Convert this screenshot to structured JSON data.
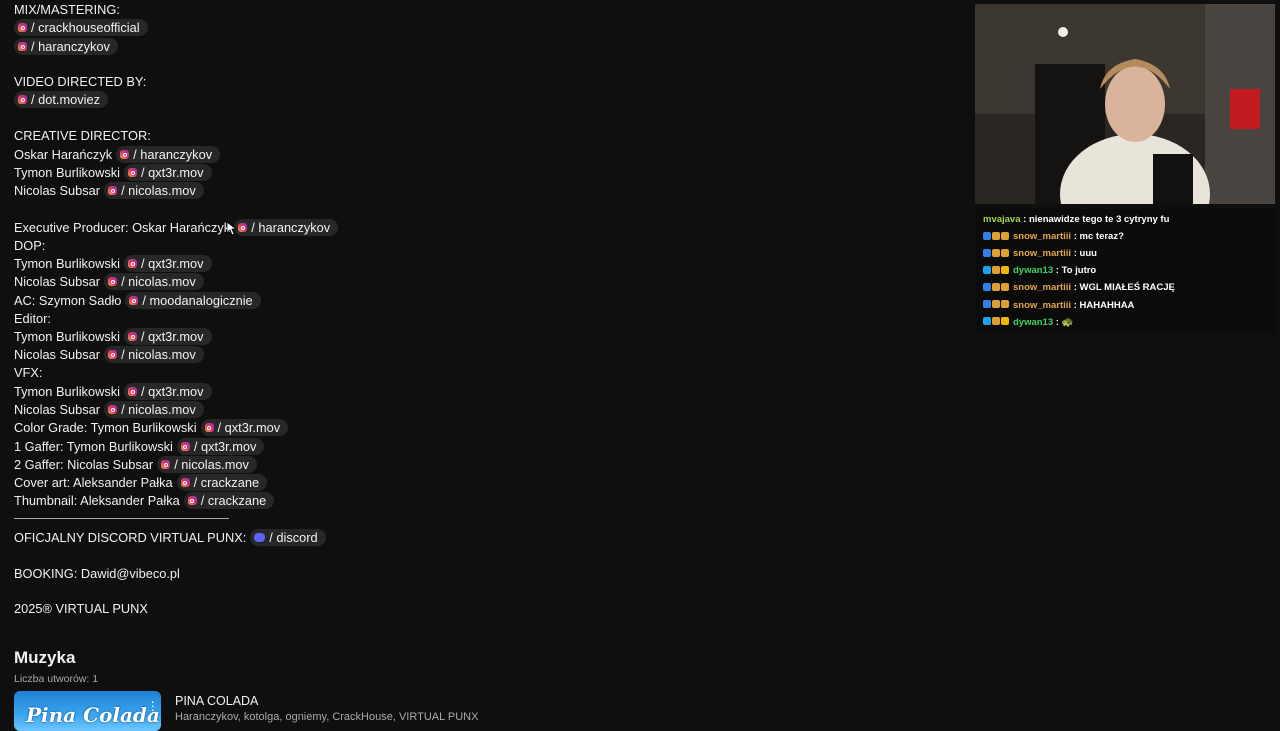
{
  "description": {
    "lines": [
      {
        "text": "MIX/MASTERING:",
        "chips": []
      },
      {
        "text": "",
        "chips": [
          {
            "icon": "instagram-icon",
            "label": "/ crackhouseofficial"
          }
        ]
      },
      {
        "text": "",
        "chips": [
          {
            "icon": "instagram-icon",
            "label": "/ haranczykov"
          }
        ]
      },
      {
        "text": "VIDEO DIRECTED BY:",
        "chips": []
      },
      {
        "text": "",
        "chips": [
          {
            "icon": "instagram-icon",
            "label": "/ dot.moviez"
          }
        ]
      },
      {
        "text": "CREATIVE DIRECTOR:",
        "chips": []
      },
      {
        "text": "Oskar Harańczyk",
        "chips": [
          {
            "icon": "instagram-icon",
            "label": "/ haranczykov"
          }
        ]
      },
      {
        "text": "Tymon Burlikowski",
        "chips": [
          {
            "icon": "instagram-icon",
            "label": "/ qxt3r.mov"
          }
        ]
      },
      {
        "text": "Nicolas Subsar",
        "chips": [
          {
            "icon": "instagram-icon",
            "label": "/ nicolas.mov"
          }
        ]
      },
      {
        "text": "Executive Producer: Oskar Harańczyk",
        "chips": [
          {
            "icon": "instagram-icon",
            "label": "/ haranczykov"
          }
        ]
      },
      {
        "text": "DOP:",
        "chips": []
      },
      {
        "text": "Tymon Burlikowski",
        "chips": [
          {
            "icon": "instagram-icon",
            "label": "/ qxt3r.mov"
          }
        ]
      },
      {
        "text": "Nicolas Subsar",
        "chips": [
          {
            "icon": "instagram-icon",
            "label": "/ nicolas.mov"
          }
        ]
      },
      {
        "text": "AC: Szymon Sadło",
        "chips": [
          {
            "icon": "instagram-icon",
            "label": "/ moodanalogicznie"
          }
        ]
      },
      {
        "text": "Editor:",
        "chips": []
      },
      {
        "text": "Tymon Burlikowski",
        "chips": [
          {
            "icon": "instagram-icon",
            "label": "/ qxt3r.mov"
          }
        ]
      },
      {
        "text": "Nicolas Subsar",
        "chips": [
          {
            "icon": "instagram-icon",
            "label": "/ nicolas.mov"
          }
        ]
      },
      {
        "text": "VFX:",
        "chips": []
      },
      {
        "text": "Tymon Burlikowski",
        "chips": [
          {
            "icon": "instagram-icon",
            "label": "/ qxt3r.mov"
          }
        ]
      },
      {
        "text": "Nicolas Subsar",
        "chips": [
          {
            "icon": "instagram-icon",
            "label": "/ nicolas.mov"
          }
        ]
      },
      {
        "text": "Color Grade: Tymon Burlikowski",
        "chips": [
          {
            "icon": "instagram-icon",
            "label": "/ qxt3r.mov"
          }
        ]
      },
      {
        "text": "1 Gaffer: Tymon Burlikowski",
        "chips": [
          {
            "icon": "instagram-icon",
            "label": "/ qxt3r.mov"
          }
        ]
      },
      {
        "text": "2 Gaffer: Nicolas Subsar",
        "chips": [
          {
            "icon": "instagram-icon",
            "label": "/ nicolas.mov"
          }
        ]
      },
      {
        "text": "Cover art: Aleksander Pałka",
        "chips": [
          {
            "icon": "instagram-icon",
            "label": "/ crackzane"
          }
        ]
      },
      {
        "text": "Thumbnail: Aleksander Pałka",
        "chips": [
          {
            "icon": "instagram-icon",
            "label": "/ crackzane"
          }
        ]
      },
      {
        "text": "———————————————————",
        "chips": []
      },
      {
        "text": "OFICJALNY DISCORD VIRTUAL PUNX:",
        "chips": [
          {
            "icon": "discord-icon",
            "label": "/ discord"
          }
        ]
      },
      {
        "text": "BOOKING: Dawid@vibeco.pl",
        "chips": []
      },
      {
        "text": "2025® VIRTUAL PUNX",
        "chips": []
      }
    ]
  },
  "music": {
    "title": "Muzyka",
    "count_label": "Liczba utworów: 1",
    "thumbnail_text": "Pina Colada",
    "track_title": "PINA COLADA",
    "track_artists": "Haranczykov, kotolga, ogniemy, CrackHouse, VIRTUAL PUNX"
  },
  "chat": {
    "messages": [
      {
        "user": "mvajava",
        "color": "#9dd34a",
        "badges": [],
        "text": "nienawidze tego te 3 cytryny fu"
      },
      {
        "user": "snow_martiii",
        "color": "#e2a84c",
        "badges": [
          "#2f80ed",
          "#e0a030",
          "#e0a030"
        ],
        "text": "mc teraz?"
      },
      {
        "user": "snow_martiii",
        "color": "#e2a84c",
        "badges": [
          "#2f80ed",
          "#e0a030",
          "#e0a030"
        ],
        "text": "uuu"
      },
      {
        "user": "dywan13",
        "color": "#3fd25d",
        "badges": [
          "#1da1f2",
          "#e0a030",
          "#f2b705"
        ],
        "text": "To jutro"
      },
      {
        "user": "snow_martiii",
        "color": "#e2a84c",
        "badges": [
          "#2f80ed",
          "#e0a030",
          "#e0a030"
        ],
        "text": "WGL MIAŁEŚ RACJĘ"
      },
      {
        "user": "snow_martiii",
        "color": "#e2a84c",
        "badges": [
          "#2f80ed",
          "#e0a030",
          "#e0a030"
        ],
        "text": "HAHAHHAA"
      },
      {
        "user": "dywan13",
        "color": "#3fd25d",
        "badges": [
          "#1da1f2",
          "#e0a030",
          "#f2b705"
        ],
        "text": "🐢"
      }
    ]
  }
}
